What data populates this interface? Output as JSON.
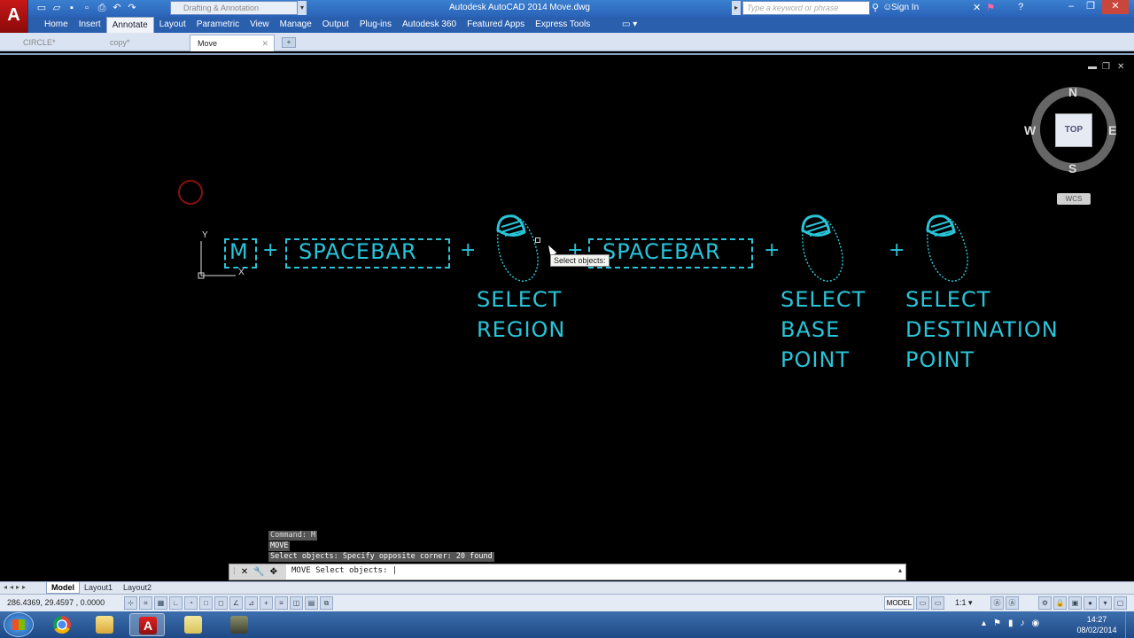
{
  "window": {
    "title": "Autodesk AutoCAD 2014    Move.dwg",
    "workspace": "Drafting & Annotation",
    "search_placeholder": "Type a keyword or phrase",
    "sign_in": "Sign In"
  },
  "ribbon_tabs": [
    "Home",
    "Insert",
    "Annotate",
    "Layout",
    "Parametric",
    "View",
    "Manage",
    "Output",
    "Plug-ins",
    "Autodesk 360",
    "Featured Apps",
    "Express Tools"
  ],
  "active_ribbon_tab": "Annotate",
  "document_tabs": [
    {
      "label": "CIRCLE*"
    },
    {
      "label": "copy*"
    },
    {
      "label": "Move",
      "active": true
    }
  ],
  "drawing": {
    "key_m": "M",
    "spacebar1": "SPACEBAR",
    "spacebar2": "SPACEBAR",
    "plus": "+",
    "select_region": [
      "SELECT",
      "REGION"
    ],
    "select_base": [
      "SELECT",
      "BASE",
      "POINT"
    ],
    "select_dest": [
      "SELECT",
      "DESTINATION",
      "POINT"
    ],
    "tooltip": "Select objects:",
    "ucs_x": "X",
    "ucs_y": "Y",
    "color": "#29c4d8"
  },
  "viewcube": {
    "n": "N",
    "s": "S",
    "e": "E",
    "w": "W",
    "face": "TOP",
    "wcs": "WCS"
  },
  "command": {
    "history": [
      "Command: M",
      "MOVE",
      "Select objects: Specify opposite corner: 20 found"
    ],
    "prompt": "MOVE Select objects: "
  },
  "layout_tabs": [
    "Model",
    "Layout1",
    "Layout2"
  ],
  "active_layout": "Model",
  "status": {
    "coords": "286.4369, 29.4597 , 0.0000",
    "model": "MODEL",
    "scale": "1:1"
  },
  "clock": {
    "time": "14:27",
    "date": "08/02/2014"
  }
}
